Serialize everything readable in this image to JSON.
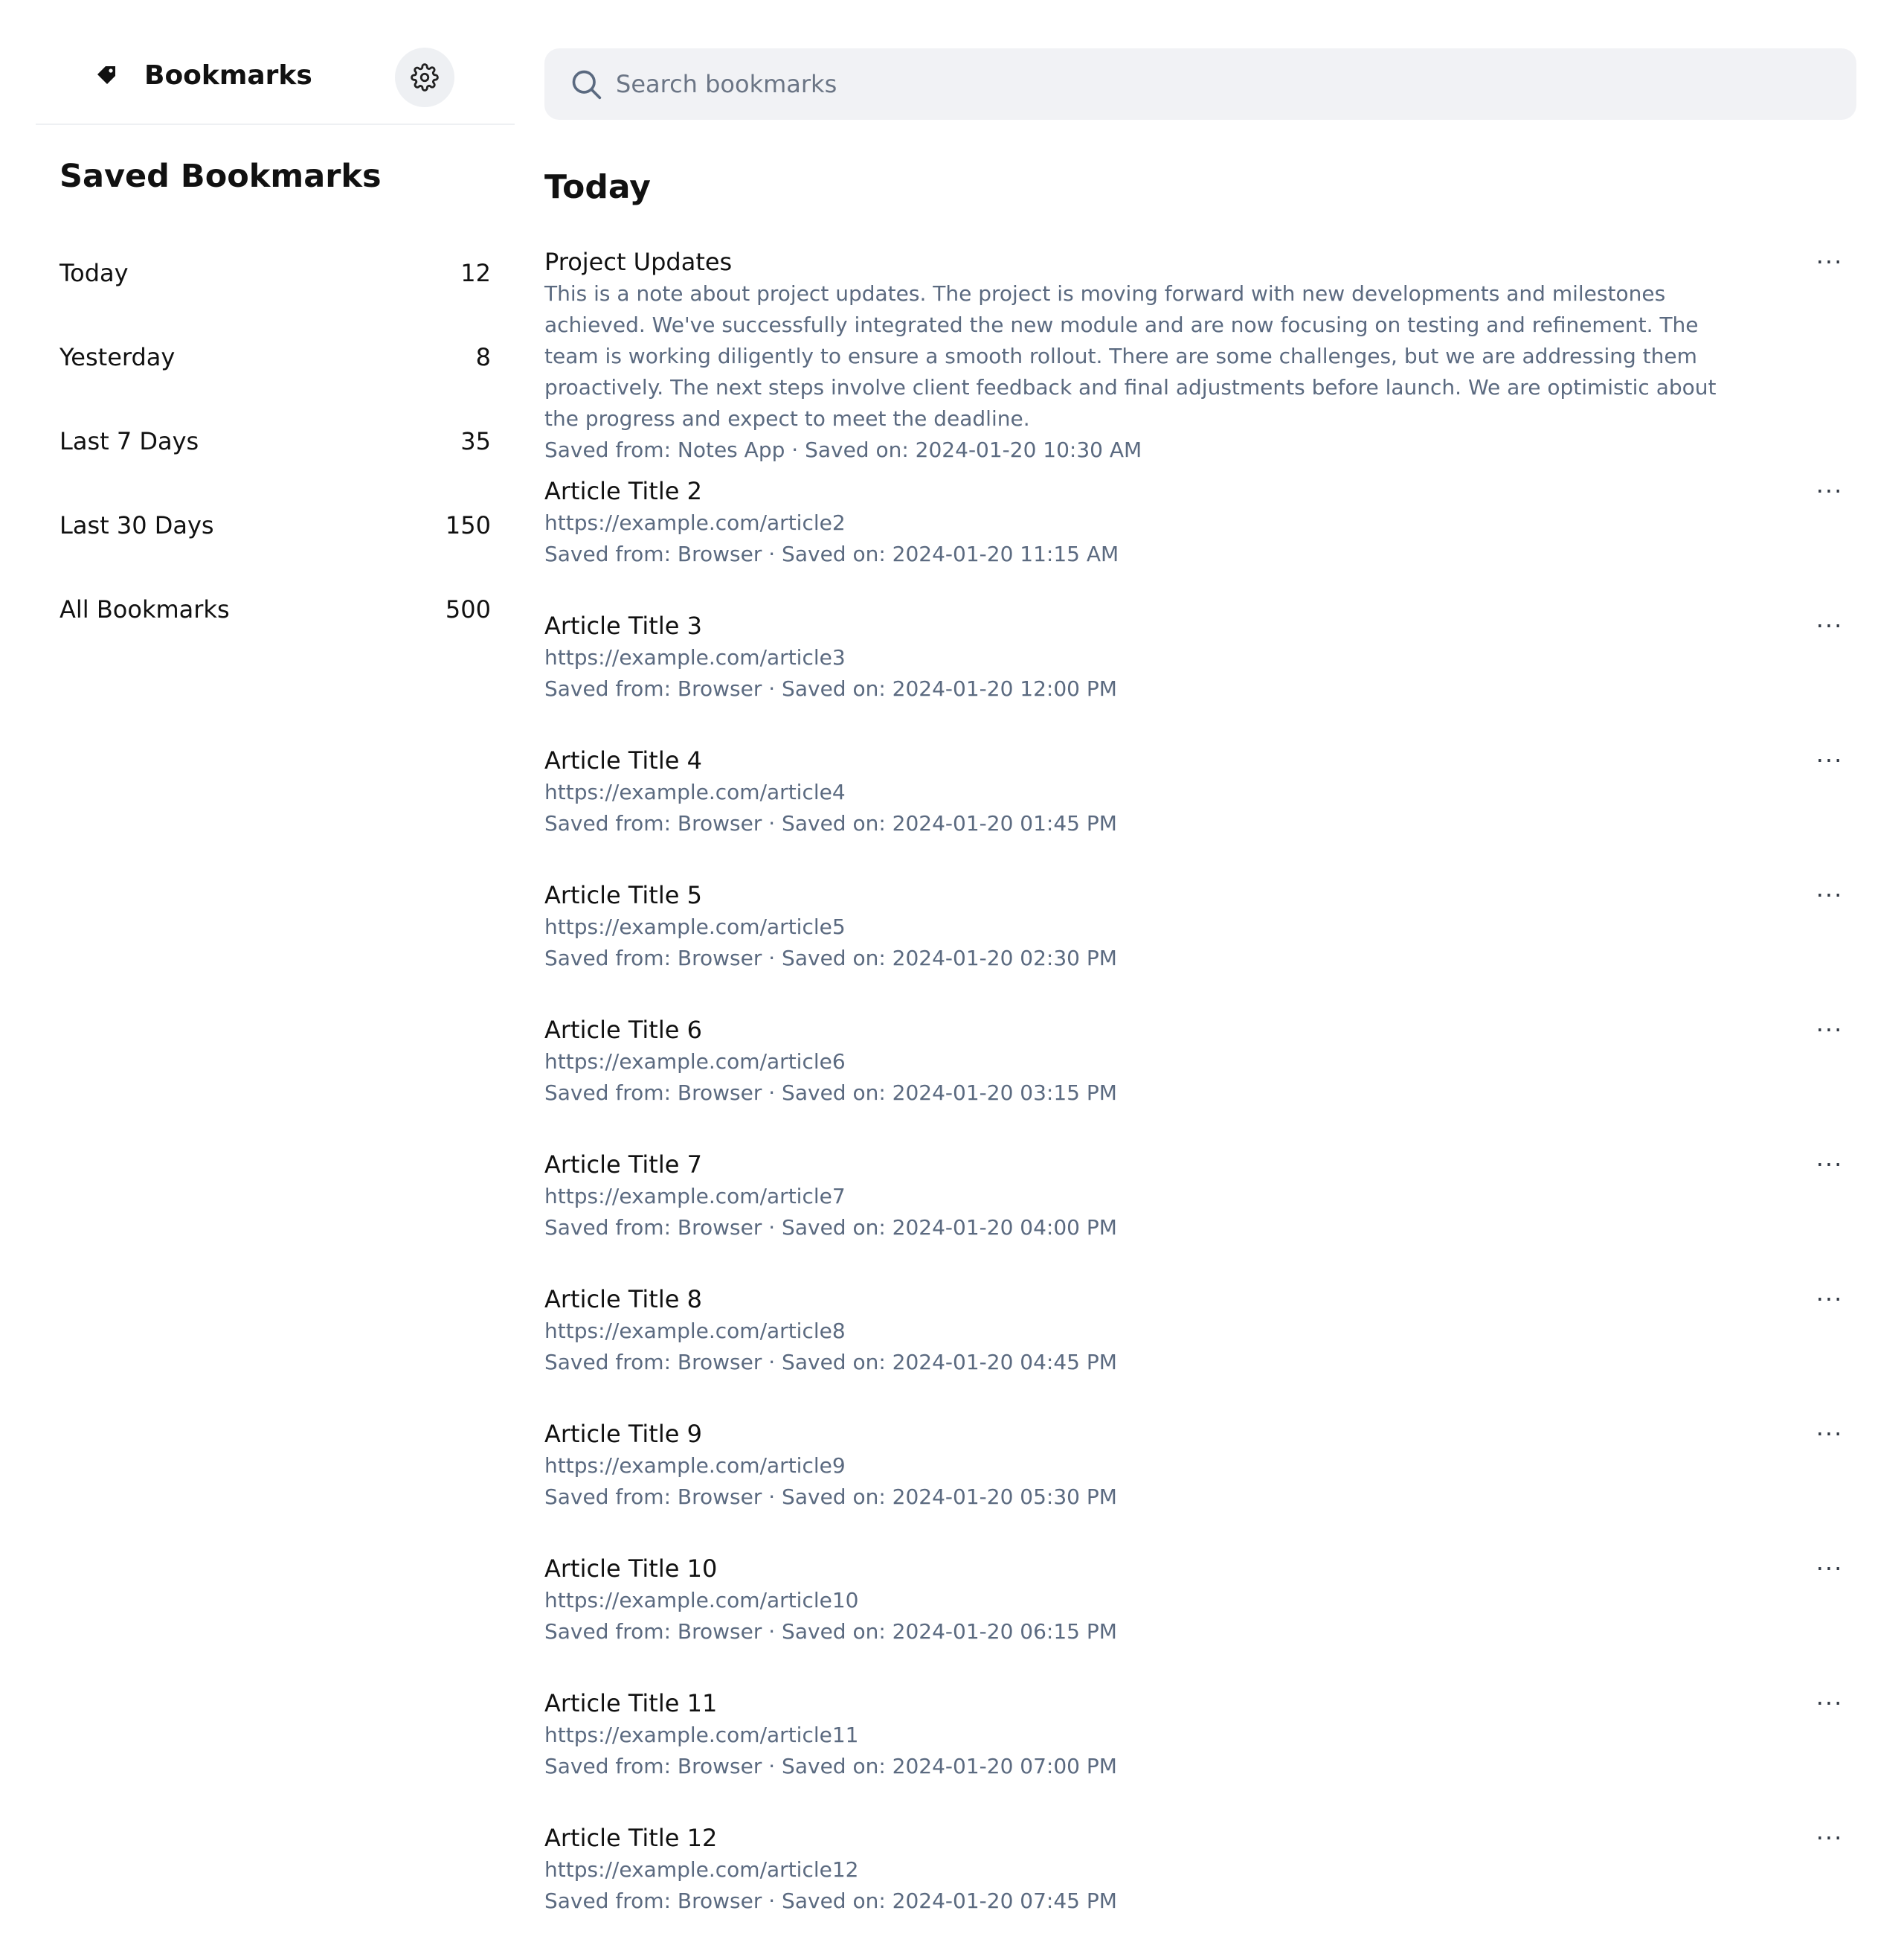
{
  "sidebar": {
    "brand_title": "Bookmarks",
    "heading": "Saved Bookmarks",
    "items": [
      {
        "label": "Today",
        "count": "12"
      },
      {
        "label": "Yesterday",
        "count": "8"
      },
      {
        "label": "Last 7 Days",
        "count": "35"
      },
      {
        "label": "Last 30 Days",
        "count": "150"
      },
      {
        "label": "All Bookmarks",
        "count": "500"
      }
    ]
  },
  "search": {
    "placeholder": "Search bookmarks",
    "value": ""
  },
  "main": {
    "section_title": "Today",
    "more_label": "···",
    "bookmarks": [
      {
        "title": "Project Updates",
        "body": "This is a note about project updates. The project is moving forward with new developments and milestones achieved. We've successfully integrated the new module and are now focusing on testing and refinement. The team is working diligently to ensure a smooth rollout. There are some challenges, but we are addressing them proactively. The next steps involve client feedback and final adjustments before launch. We are optimistic about the progress and expect to meet the deadline.",
        "meta": "Saved from: Notes App · Saved on: 2024-01-20 10:30 AM"
      },
      {
        "title": "Article Title 2",
        "url": "https://example.com/article2",
        "meta": "Saved from: Browser · Saved on: 2024-01-20 11:15 AM"
      },
      {
        "title": "Article Title 3",
        "url": "https://example.com/article3",
        "meta": "Saved from: Browser · Saved on: 2024-01-20 12:00 PM"
      },
      {
        "title": "Article Title 4",
        "url": "https://example.com/article4",
        "meta": "Saved from: Browser · Saved on: 2024-01-20 01:45 PM"
      },
      {
        "title": "Article Title 5",
        "url": "https://example.com/article5",
        "meta": "Saved from: Browser · Saved on: 2024-01-20 02:30 PM"
      },
      {
        "title": "Article Title 6",
        "url": "https://example.com/article6",
        "meta": "Saved from: Browser · Saved on: 2024-01-20 03:15 PM"
      },
      {
        "title": "Article Title 7",
        "url": "https://example.com/article7",
        "meta": "Saved from: Browser · Saved on: 2024-01-20 04:00 PM"
      },
      {
        "title": "Article Title 8",
        "url": "https://example.com/article8",
        "meta": "Saved from: Browser · Saved on: 2024-01-20 04:45 PM"
      },
      {
        "title": "Article Title 9",
        "url": "https://example.com/article9",
        "meta": "Saved from: Browser · Saved on: 2024-01-20 05:30 PM"
      },
      {
        "title": "Article Title 10",
        "url": "https://example.com/article10",
        "meta": "Saved from: Browser · Saved on: 2024-01-20 06:15 PM"
      },
      {
        "title": "Article Title 11",
        "url": "https://example.com/article11",
        "meta": "Saved from: Browser · Saved on: 2024-01-20 07:00 PM"
      },
      {
        "title": "Article Title 12",
        "url": "https://example.com/article12",
        "meta": "Saved from: Browser · Saved on: 2024-01-20 07:45 PM"
      }
    ]
  },
  "colors": {
    "text_primary": "#111111",
    "text_secondary": "#5b6a80",
    "surface": "#f1f2f5",
    "divider": "#eef0f3"
  },
  "icons": {
    "brand": "tag-icon",
    "settings": "gear-icon",
    "search": "search-icon",
    "more": "more-horizontal-icon"
  }
}
